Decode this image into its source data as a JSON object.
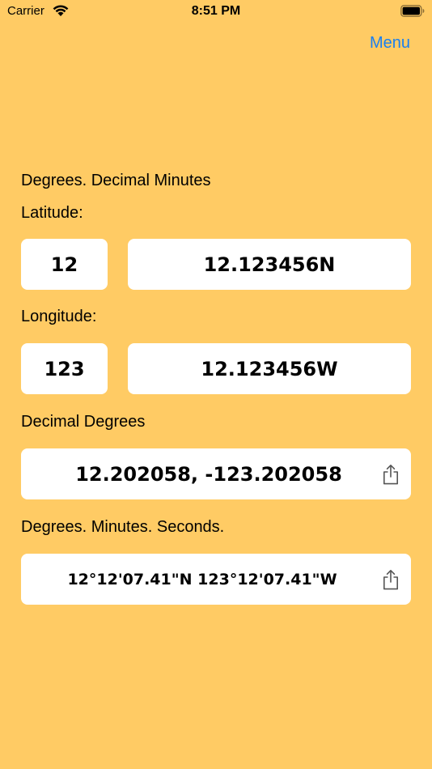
{
  "status_bar": {
    "carrier": "Carrier",
    "time": "8:51 PM",
    "icons": [
      "wifi-icon",
      "battery-icon"
    ]
  },
  "nav": {
    "menu_label": "Menu"
  },
  "ddm": {
    "heading": "Degrees. Decimal Minutes",
    "latitude_label": "Latitude:",
    "latitude_degrees": "12",
    "latitude_minutes": "12.123456N",
    "longitude_label": "Longitude:",
    "longitude_degrees": "123",
    "longitude_minutes": "12.123456W"
  },
  "dd": {
    "heading": "Decimal Degrees",
    "value": "12.202058, -123.202058",
    "share_icon": "share-icon"
  },
  "dms": {
    "heading": "Degrees. Minutes. Seconds.",
    "value": "12°12'07.41\"N 123°12'07.41\"W",
    "share_icon": "share-icon"
  },
  "colors": {
    "background": "#ffcb64",
    "accent": "#1a7ff0",
    "field": "#ffffff"
  }
}
